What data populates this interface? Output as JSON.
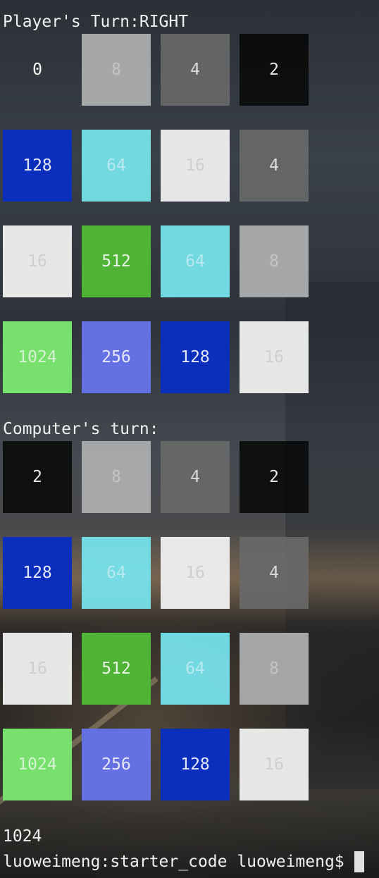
{
  "player_section": {
    "title": "Player's Turn:RIGHT",
    "board": [
      [
        "0",
        "8",
        "4",
        "2"
      ],
      [
        "128",
        "64",
        "16",
        "4"
      ],
      [
        "16",
        "512",
        "64",
        "8"
      ],
      [
        "1024",
        "256",
        "128",
        "16"
      ]
    ]
  },
  "computer_section": {
    "title": "Computer's turn:",
    "board": [
      [
        "2",
        "8",
        "4",
        "2"
      ],
      [
        "128",
        "64",
        "16",
        "4"
      ],
      [
        "16",
        "512",
        "64",
        "8"
      ],
      [
        "1024",
        "256",
        "128",
        "16"
      ]
    ]
  },
  "score": "1024",
  "prompt": "luoweimeng:starter_code luoweimeng$"
}
